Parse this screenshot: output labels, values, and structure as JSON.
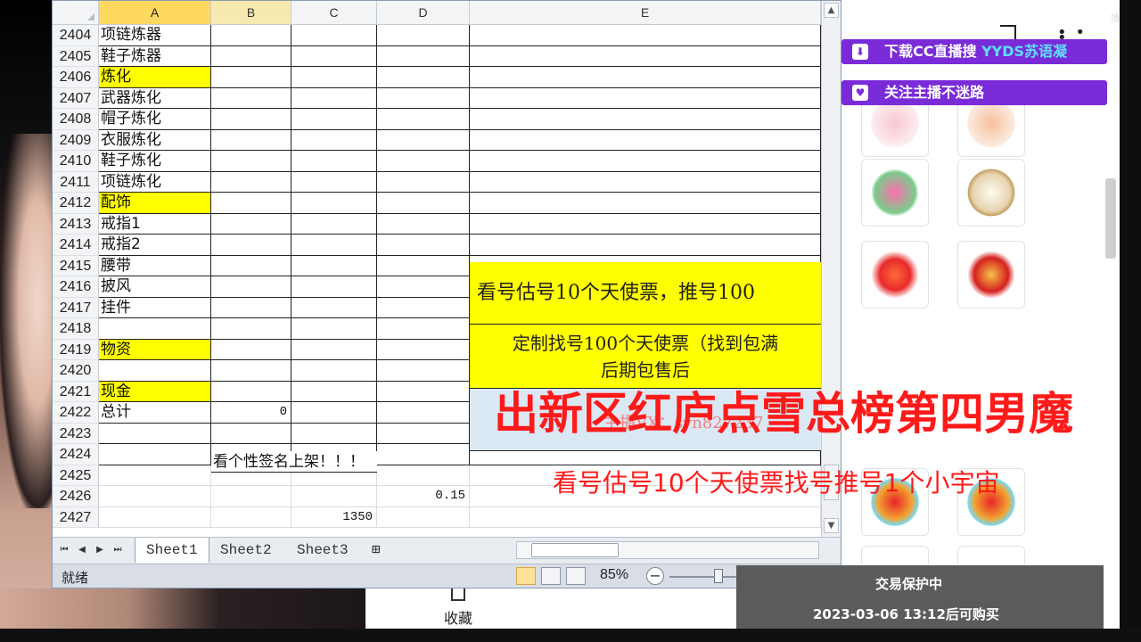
{
  "spreadsheet": {
    "columns": [
      "A",
      "B",
      "C",
      "D",
      "E"
    ],
    "rows": [
      {
        "num": "2404",
        "a": "项链炼器",
        "style": "border"
      },
      {
        "num": "2405",
        "a": "鞋子炼器",
        "style": "border"
      },
      {
        "num": "2406",
        "a": "炼化",
        "yellow": true,
        "style": "border"
      },
      {
        "num": "2407",
        "a": "武器炼化",
        "style": "border"
      },
      {
        "num": "2408",
        "a": "帽子炼化",
        "style": "border"
      },
      {
        "num": "2409",
        "a": "衣服炼化",
        "style": "border"
      },
      {
        "num": "2410",
        "a": "鞋子炼化",
        "style": "border"
      },
      {
        "num": "2411",
        "a": "项链炼化",
        "style": "border"
      },
      {
        "num": "2412",
        "a": "配饰",
        "yellow": true,
        "style": "border"
      },
      {
        "num": "2413",
        "a": "戒指1",
        "style": "border"
      },
      {
        "num": "2414",
        "a": "戒指2",
        "style": "border"
      },
      {
        "num": "2415",
        "a": "腰带",
        "style": "border"
      },
      {
        "num": "2416",
        "a": "披风",
        "style": "border"
      },
      {
        "num": "2417",
        "a": "挂件",
        "style": "border"
      },
      {
        "num": "2418",
        "a": "",
        "style": "border"
      },
      {
        "num": "2419",
        "a": "物资",
        "yellow": true,
        "style": "border"
      },
      {
        "num": "2420",
        "a": "",
        "style": "border"
      },
      {
        "num": "2421",
        "a": "现金",
        "yellow": true,
        "style": "border"
      },
      {
        "num": "2422",
        "a": "总计",
        "b": "0",
        "style": "border"
      },
      {
        "num": "2423",
        "a": "",
        "style": "border"
      },
      {
        "num": "2424",
        "a": "",
        "style": "border"
      },
      {
        "num": "2425",
        "a": "",
        "style": "light"
      },
      {
        "num": "2426",
        "a": "",
        "d": "0.15",
        "style": "light"
      },
      {
        "num": "2427",
        "a": "",
        "c": "1350",
        "style": "light"
      }
    ],
    "merged_e_1": "看号估号10个天使票，推号100",
    "merged_e_2_line1": "定制找号100个天使票（找到包满",
    "merged_e_2_line2": "后期包售后",
    "merged_e_3": "主播VX：syn827237",
    "row_2424_text": "看个性签名上架！！！"
  },
  "sheets": {
    "tabs": [
      "Sheet1",
      "Sheet2",
      "Sheet3"
    ],
    "active": "Sheet1"
  },
  "statusbar": {
    "status": "就绪",
    "zoom": "85%"
  },
  "side_panel": {
    "promo_download": "下载CC直播搜",
    "promo_download_highlight": "YYDS苏语凝",
    "promo_follow": "关注主播不迷路",
    "trade_title": "交易保护中",
    "trade_time": "2023-03-06 13:12后可购买",
    "collect_label": "收藏",
    "corner_text": "播"
  },
  "overlay": {
    "title": "出新区红庐点雪总榜第四男魔",
    "subtitle": "看号估号10个天使票找号推号1个小宇宙"
  },
  "colors": {
    "highlight_yellow": "#ffff00",
    "overlay_red": "#ff1a1a",
    "promo_purple": "#7a2bd8"
  }
}
